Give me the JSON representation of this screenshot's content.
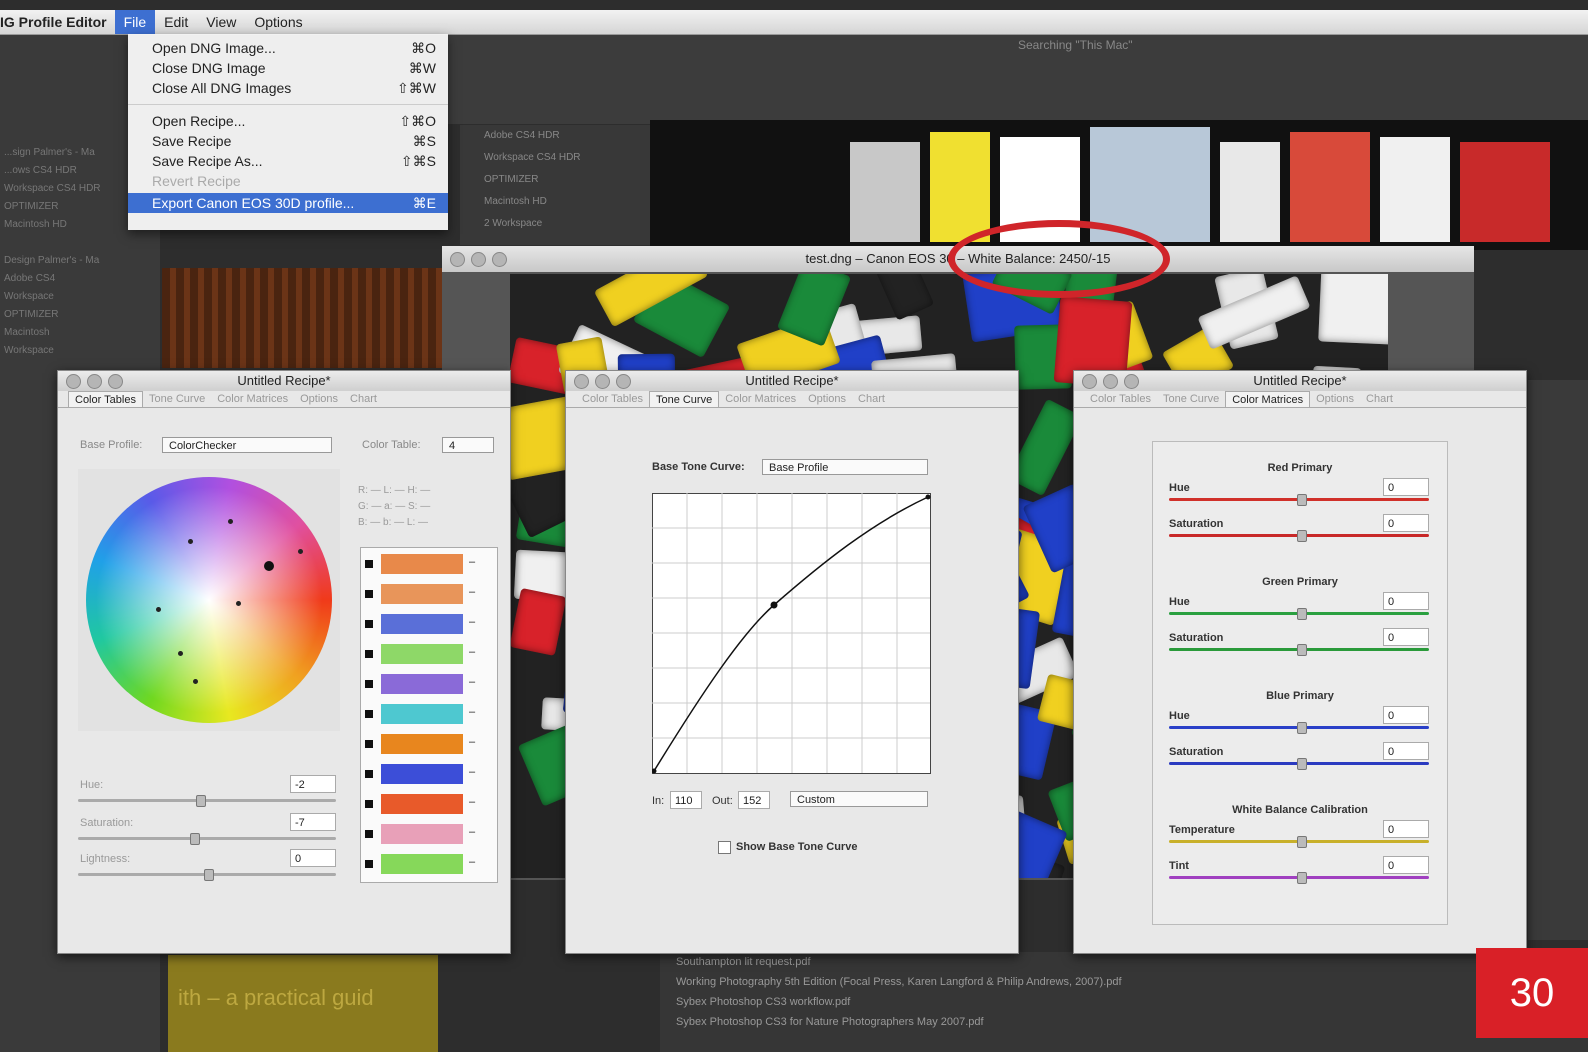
{
  "menubar": {
    "app": "IG Profile Editor",
    "items": [
      "File",
      "Edit",
      "View",
      "Options"
    ],
    "active": "File"
  },
  "file_menu": {
    "items": [
      {
        "label": "Open DNG Image...",
        "shortcut": "⌘O"
      },
      {
        "label": "Close DNG Image",
        "shortcut": "⌘W"
      },
      {
        "label": "Close All DNG Images",
        "shortcut": "⇧⌘W"
      },
      {
        "label": "Open Recipe...",
        "shortcut": "⇧⌘O"
      },
      {
        "label": "Save Recipe",
        "shortcut": "⌘S"
      },
      {
        "label": "Save Recipe As...",
        "shortcut": "⇧⌘S"
      },
      {
        "label": "Revert Recipe",
        "shortcut": ""
      },
      {
        "label": "Export Canon EOS 30D profile...",
        "shortcut": "⌘E"
      }
    ]
  },
  "image_window": {
    "title": "test.dng  –  Canon EOS 30",
    "title_suffix": "– White Balance: 2450/-15"
  },
  "finder": {
    "search_title": "Searching \"This Mac\"",
    "sidebar": [
      "...sign Palmer's - Ma",
      "...ows CS4 HDR",
      "Workspace CS4 HDR",
      "OPTIMIZER",
      "Macintosh HD",
      "",
      "Design Palmer's - Ma",
      "Adobe CS4",
      "Workspace",
      "OPTIMIZER",
      "Macintosh",
      "Workspace"
    ],
    "files": [
      "Adobe CS4 HDR",
      "Workspace CS4 HDR",
      "OPTIMIZER",
      "Macintosh HD",
      "2 Workspace"
    ],
    "bottom": [
      "Southampton lit request.pdf",
      "Working Photography 5th Edition (Focal Press, Karen Langford & Philip Andrews, 2007).pdf",
      "Sybex Photoshop CS3 workflow.pdf",
      "Sybex Photoshop CS3 for Nature Photographers May 2007.pdf"
    ],
    "book_title": "ith – a practical guid"
  },
  "panel_left": {
    "title": "Untitled Recipe*",
    "tabs": [
      "Color Tables",
      "Tone Curve",
      "Color Matrices",
      "Options",
      "Chart"
    ],
    "active_tab": "Color Tables",
    "base_profile_label": "Base Profile:",
    "base_profile_value": "ColorChecker",
    "color_table_label": "Color Table:",
    "color_table_value": "4",
    "hue_label": "Hue:",
    "hue_value": "-2",
    "saturation_label": "Saturation:",
    "saturation_value": "-7",
    "lightness_label": "Lightness:",
    "lightness_value": "0",
    "swatches": [
      "#e8894a",
      "#e8955a",
      "#5a6fd8",
      "#8ed868",
      "#8a6ad8",
      "#4ec8d0",
      "#e8861e",
      "#3c4ed8",
      "#e85a2a",
      "#e8a0b8",
      "#86d85a"
    ]
  },
  "panel_mid": {
    "title": "Untitled Recipe*",
    "tabs": [
      "Color Tables",
      "Tone Curve",
      "Color Matrices",
      "Options",
      "Chart"
    ],
    "active_tab": "Tone Curve",
    "base_curve_label": "Base Tone Curve:",
    "base_curve_value": "Base Profile",
    "in_label": "In:",
    "in_value": "110",
    "out_label": "Out:",
    "out_value": "152",
    "mode_value": "Custom",
    "show_base_label": "Show Base Tone Curve"
  },
  "panel_right": {
    "title": "Untitled Recipe*",
    "tabs": [
      "Color Tables",
      "Tone Curve",
      "Color Matrices",
      "Options",
      "Chart"
    ],
    "active_tab": "Color Matrices",
    "groups": [
      {
        "title": "Red Primary",
        "rows": [
          {
            "label": "Hue",
            "value": "0",
            "color": "#d0302a"
          },
          {
            "label": "Saturation",
            "value": "0",
            "color": "#c82828"
          }
        ]
      },
      {
        "title": "Green Primary",
        "rows": [
          {
            "label": "Hue",
            "value": "0",
            "color": "#2aa040"
          },
          {
            "label": "Saturation",
            "value": "0",
            "color": "#2a9a3a"
          }
        ]
      },
      {
        "title": "Blue Primary",
        "rows": [
          {
            "label": "Hue",
            "value": "0",
            "color": "#2a40c8"
          },
          {
            "label": "Saturation",
            "value": "0",
            "color": "#2a3ac0"
          }
        ]
      },
      {
        "title": "White Balance Calibration",
        "rows": [
          {
            "label": "Temperature",
            "value": "0",
            "color": "#c8b02a"
          },
          {
            "label": "Tint",
            "value": "0",
            "color": "#a040c0"
          }
        ]
      }
    ]
  },
  "page_badge": "30",
  "colors": {
    "highlight": "#3d6fd1",
    "annotation": "#d0252a",
    "badge": "#d92027"
  }
}
